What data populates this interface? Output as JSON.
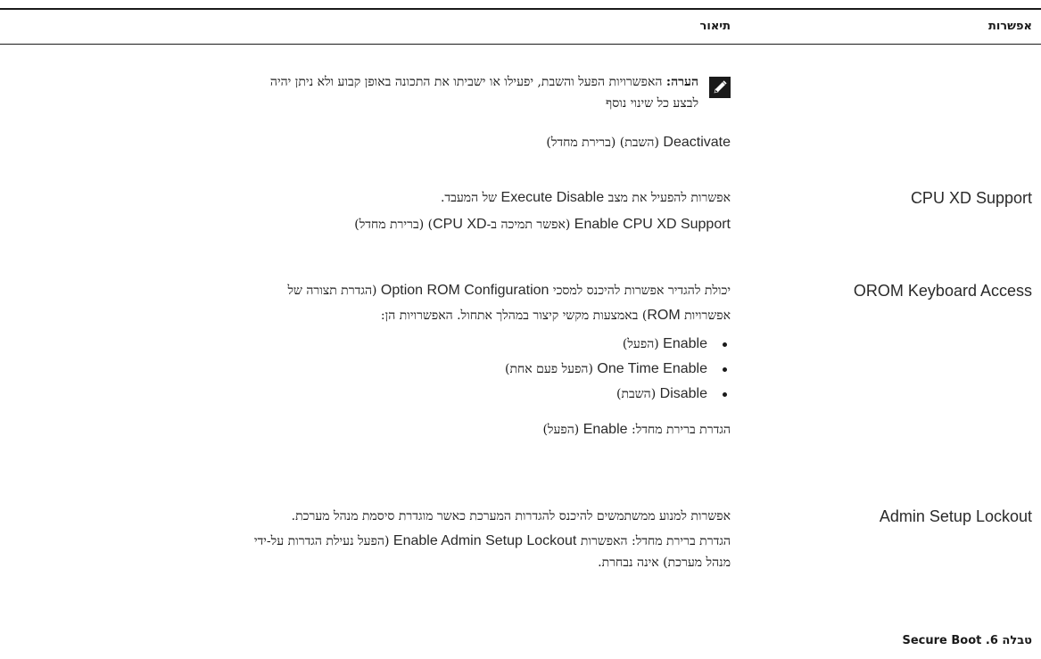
{
  "table": {
    "header": {
      "option": "אפשרות",
      "description": "תיאור"
    },
    "note": {
      "icon": "note-pencil-icon",
      "label": "הערה:",
      "line1": "האפשרויות הפעל והשבת, יפעילו או ישביתו את התכונה באופן קבוע ולא ניתן יהיה",
      "line2": "לבצע כל שינוי נוסף"
    },
    "deactivate": {
      "ltr": "Deactivate",
      "rtl": "(השבת) (ברירת מחדל)"
    },
    "rows": [
      {
        "option": "CPU XD Support",
        "desc1_a": "אפשרות להפעיל את מצב",
        "desc1_ltr": "Execute Disable",
        "desc1_b": "של המעבד.",
        "desc2_ltr": "Enable CPU XD Support",
        "desc2_b": "(אפשר תמיכה ב-",
        "desc2_ltr2": "CPU XD",
        "desc2_c": ") (ברירת מחדל)"
      },
      {
        "option": "OROM Keyboard Access",
        "line1_a": "יכולת להגדיר אפשרות להיכנס למסכי",
        "line1_ltr": "Option ROM Configuration",
        "line1_b": "(הגדרת תצורה של",
        "line2_a": "אפשרויות",
        "line2_ltr": "ROM",
        "line2_b": ") באמצעות מקשי קיצור במהלך אתחול. האפשרויות הן:",
        "bullets": [
          {
            "ltr": "Enable",
            "rtl": "(הפעל)"
          },
          {
            "ltr": "One Time Enable",
            "rtl": "(הפעל פעם אחת)"
          },
          {
            "ltr": "Disable",
            "rtl": "(השבת)"
          }
        ],
        "default_a": "הגדרת ברירת מחדל:",
        "default_ltr": "Enable",
        "default_b": "(הפעל)"
      },
      {
        "option": "Admin Setup Lockout",
        "line1": "אפשרות למנוע ממשתמשים להיכנס להגדרות המערכת כאשר מוגדרת סיסמת מנהל מערכת.",
        "line2_a": "הגדרת ברירת מחדל: האפשרות",
        "line2_ltr": "Enable Admin Setup Lockout",
        "line2_b": "(הפעל נעילת הגדרות על-ידי",
        "line3": "מנהל מערכת) אינה נבחרת."
      }
    ]
  },
  "caption": {
    "prefix": "טבלה 6.",
    "title": "Secure Boot"
  }
}
